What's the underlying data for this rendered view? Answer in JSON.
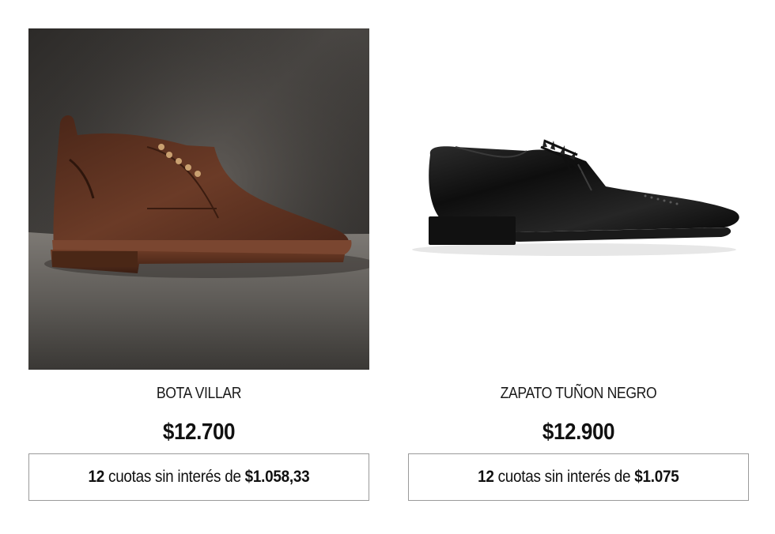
{
  "products": [
    {
      "name": "BOTA VILLAR",
      "price": "$12.700",
      "installments": {
        "count": "12",
        "text": " cuotas sin interés de ",
        "amount": "$1.058,33"
      },
      "image_icon": "brown-leather-chukka-boot"
    },
    {
      "name": "ZAPATO TUÑON NEGRO",
      "price": "$12.900",
      "installments": {
        "count": "12",
        "text": " cuotas sin interés de ",
        "amount": "$1.075"
      },
      "image_icon": "black-leather-oxford-shoe"
    }
  ],
  "colors": {
    "border": "#9a9a9a",
    "text": "#111111",
    "backdrop_dark": "#3b3835",
    "boot_brown": "#5a3222",
    "shoe_black": "#141414"
  }
}
